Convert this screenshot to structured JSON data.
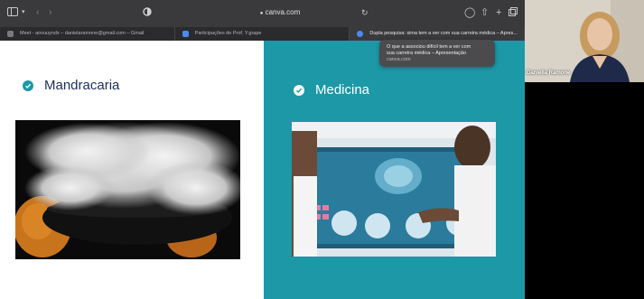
{
  "browser": {
    "address": "canva.com",
    "tabs": [
      {
        "label": "Meet - aovuuyndx – danielaramone@gmail.com – Gmail",
        "active": false
      },
      {
        "label": "Participações de Prof. Y.grape",
        "active": false
      },
      {
        "label": "Dupla pesquisa: sima tem a ver com sua carreira médica – Apres...",
        "active": true
      }
    ]
  },
  "tooltip": {
    "line1": "O que a associou difícil tem a ver com",
    "line2": "sua carreira médica – Apresentação",
    "host": "canva.com"
  },
  "slide": {
    "left_title": "Mandracaria",
    "right_title": "Medicina"
  },
  "call": {
    "participant_name": "Daniella Ramone"
  },
  "colors": {
    "teal": "#1c98a7",
    "navy": "#1d2f5a"
  }
}
